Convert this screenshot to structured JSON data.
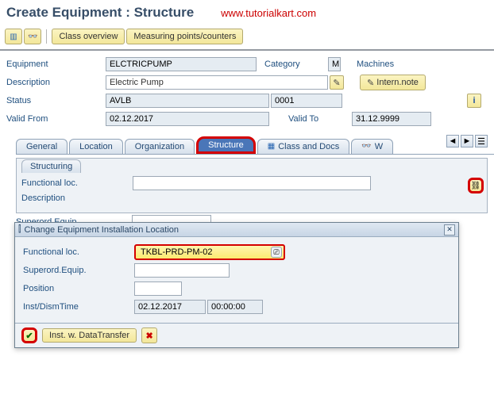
{
  "header": {
    "title": "Create Equipment : Structure",
    "url": "www.tutorialkart.com"
  },
  "toolbar": {
    "class_overview": "Class overview",
    "measuring": "Measuring points/counters"
  },
  "form": {
    "equipment_label": "Equipment",
    "equipment_value": "ELCTRICPUMP",
    "category_label": "Category",
    "category_value": "M",
    "category_text": "Machines",
    "description_label": "Description",
    "description_value": "Electric Pump",
    "intern_note": "Intern.note",
    "status_label": "Status",
    "status_value": "AVLB",
    "status_code": "0001",
    "valid_from_label": "Valid From",
    "valid_from_value": "02.12.2017",
    "valid_to_label": "Valid To",
    "valid_to_value": "31.12.9999"
  },
  "tabs": {
    "general": "General",
    "location": "Location",
    "organization": "Organization",
    "structure": "Structure",
    "class_docs": "Class and Docs",
    "w": "W"
  },
  "structuring": {
    "panel_title": "Structuring",
    "funcloc_label": "Functional loc.",
    "description_label": "Description",
    "superord_label": "Superord.Equip."
  },
  "popup": {
    "title": "Change Equipment Installation Location",
    "funcloc_label": "Functional loc.",
    "funcloc_value": "TKBL-PRD-PM-02",
    "superord_label": "Superord.Equip.",
    "position_label": "Position",
    "instdism_label": "Inst/DismTime",
    "instdism_date": "02.12.2017",
    "instdism_time": "00:00:00",
    "inst_btn": "Inst. w. DataTransfer"
  }
}
